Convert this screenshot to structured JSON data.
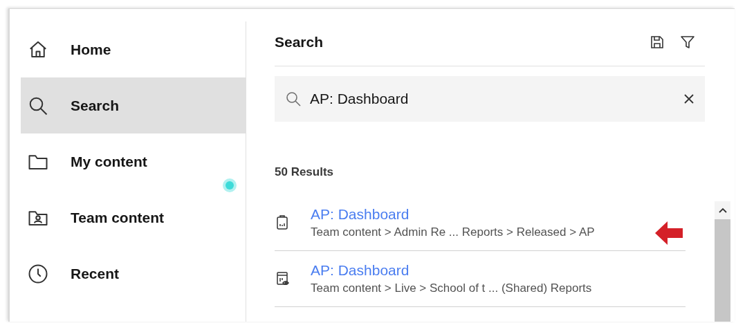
{
  "sidebar": {
    "items": [
      {
        "label": "Home",
        "kind": "home",
        "selected": false
      },
      {
        "label": "Search",
        "kind": "search",
        "selected": true
      },
      {
        "label": "My content",
        "kind": "folder",
        "selected": false
      },
      {
        "label": "Team content",
        "kind": "team",
        "selected": false
      },
      {
        "label": "Recent",
        "kind": "recent",
        "selected": false
      }
    ]
  },
  "main": {
    "title": "Search",
    "search": {
      "value": "AP: Dashboard"
    },
    "results_count": "50 Results",
    "results": [
      {
        "kind": "report",
        "title": "AP: Dashboard",
        "path": "Team content > Admin Re ... Reports > Released > AP",
        "annotated": true
      },
      {
        "kind": "report-view",
        "title": "AP: Dashboard",
        "path": "Team content > Live > School of t ... (Shared) Reports",
        "annotated": false
      }
    ]
  }
}
